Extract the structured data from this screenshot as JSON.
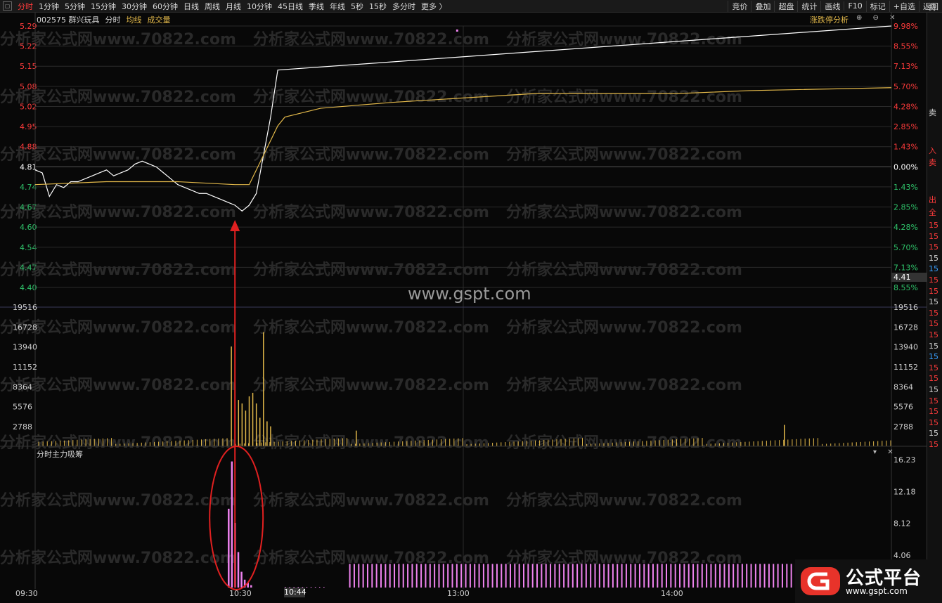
{
  "toolbar": {
    "items": [
      "分时",
      "1分钟",
      "5分钟",
      "15分钟",
      "30分钟",
      "60分钟",
      "日线",
      "周线",
      "月线",
      "10分钟",
      "45日线",
      "季线",
      "年线",
      "5秒",
      "15秒",
      "多分时",
      "更多 〉"
    ],
    "right_items": [
      "竞价",
      "叠加",
      "超盘",
      "统计",
      "画线",
      "F10",
      "标记",
      "+自选",
      "返回"
    ]
  },
  "title": {
    "code": "002575 群兴玩具",
    "mode": "分时",
    "avg_label": "均线",
    "vol_label": "成交量"
  },
  "limit_analysis": "涨跌停分析",
  "window_icons": "⊕ ⊖ ✕",
  "sub_chart": {
    "title": "分时主力吸筹",
    "icons": "▾ ✕"
  },
  "current_price_tag": "4.41",
  "current_time_tag": "10:44",
  "watermark_center": "www.gspt.com",
  "watermark_repeat": "分析家公式网www.70822.com",
  "logo": {
    "name": "公式平台",
    "url": "www.gspt.com",
    "color": "#e8332a"
  },
  "right_strip": [
    "卖",
    "入",
    "卖",
    "出",
    "全",
    "15",
    "15",
    "15",
    "15",
    "15",
    "15",
    "15",
    "15",
    "15",
    "15",
    "15",
    "15",
    "15",
    "15",
    "15",
    "15",
    "15",
    "15",
    "15",
    "15",
    "15"
  ],
  "right_strip_top": "持",
  "colors": {
    "up": "#ff3b3b",
    "down": "#2fc36a",
    "avg": "#e2b84a",
    "price": "#ffffff",
    "pink": "#ee82ee"
  },
  "chart_data": [
    {
      "type": "line",
      "title": "分时",
      "y_left_labels": [
        "5.29",
        "5.22",
        "5.15",
        "5.08",
        "5.02",
        "4.95",
        "4.88",
        "4.81",
        "4.74",
        "4.67",
        "4.60",
        "4.54",
        "4.47",
        "4.40"
      ],
      "y_right_labels": [
        "9.98%",
        "8.55%",
        "7.13%",
        "5.70%",
        "4.28%",
        "2.85%",
        "1.43%",
        "0.00%",
        "1.43%",
        "2.85%",
        "4.28%",
        "5.70%",
        "7.13%",
        "8.55%"
      ],
      "prev_close": 4.81,
      "ylim": [
        4.4,
        5.29
      ],
      "x_labels": [
        "09:30",
        "10:30",
        "13:00",
        "14:00"
      ],
      "series": [
        {
          "name": "price",
          "t": [
            0,
            2,
            4,
            6,
            8,
            10,
            12,
            14,
            16,
            18,
            20,
            22,
            24,
            26,
            28,
            30,
            32,
            34,
            36,
            38,
            40,
            42,
            44,
            46,
            48,
            50,
            52,
            54,
            56,
            58,
            60,
            62,
            64,
            66,
            68,
            240
          ],
          "values": [
            4.8,
            4.79,
            4.71,
            4.75,
            4.74,
            4.76,
            4.76,
            4.77,
            4.78,
            4.79,
            4.8,
            4.78,
            4.79,
            4.8,
            4.82,
            4.83,
            4.82,
            4.81,
            4.79,
            4.77,
            4.75,
            4.74,
            4.73,
            4.72,
            4.72,
            4.71,
            4.7,
            4.69,
            4.68,
            4.66,
            4.68,
            4.72,
            4.85,
            4.98,
            5.14,
            5.29
          ]
        },
        {
          "name": "均线",
          "t": [
            0,
            20,
            40,
            56,
            60,
            64,
            68,
            70,
            80,
            100,
            140,
            180,
            200,
            240
          ],
          "values": [
            4.75,
            4.76,
            4.76,
            4.75,
            4.75,
            4.85,
            4.95,
            4.98,
            5.01,
            5.03,
            5.06,
            5.06,
            5.07,
            5.08
          ]
        }
      ]
    },
    {
      "type": "bar",
      "title": "成交量",
      "y_labels": [
        "19516",
        "16728",
        "13940",
        "11152",
        "8364",
        "5576",
        "2788"
      ],
      "ylim": [
        0,
        19516
      ],
      "spikes": [
        {
          "t": 56,
          "v": 17800
        },
        {
          "t": 55,
          "v": 14000
        },
        {
          "t": 57,
          "v": 6500
        },
        {
          "t": 58,
          "v": 6000
        },
        {
          "t": 59,
          "v": 5000
        },
        {
          "t": 60,
          "v": 7000
        },
        {
          "t": 61,
          "v": 7500
        },
        {
          "t": 62,
          "v": 6000
        },
        {
          "t": 63,
          "v": 4000
        },
        {
          "t": 64,
          "v": 16000
        },
        {
          "t": 65,
          "v": 3500
        },
        {
          "t": 66,
          "v": 2800
        },
        {
          "t": 90,
          "v": 2200
        },
        {
          "t": 210,
          "v": 3000
        }
      ]
    },
    {
      "type": "bar",
      "title": "分时主力吸筹",
      "y_labels": [
        "16.23",
        "12.18",
        "8.12",
        "4.06"
      ],
      "ylim": [
        0,
        16.23
      ],
      "values_early": [
        10.0,
        16.0,
        8.2,
        4.5,
        2.0,
        1.0,
        0.6,
        0.3
      ],
      "flat_value": 3.0
    }
  ]
}
